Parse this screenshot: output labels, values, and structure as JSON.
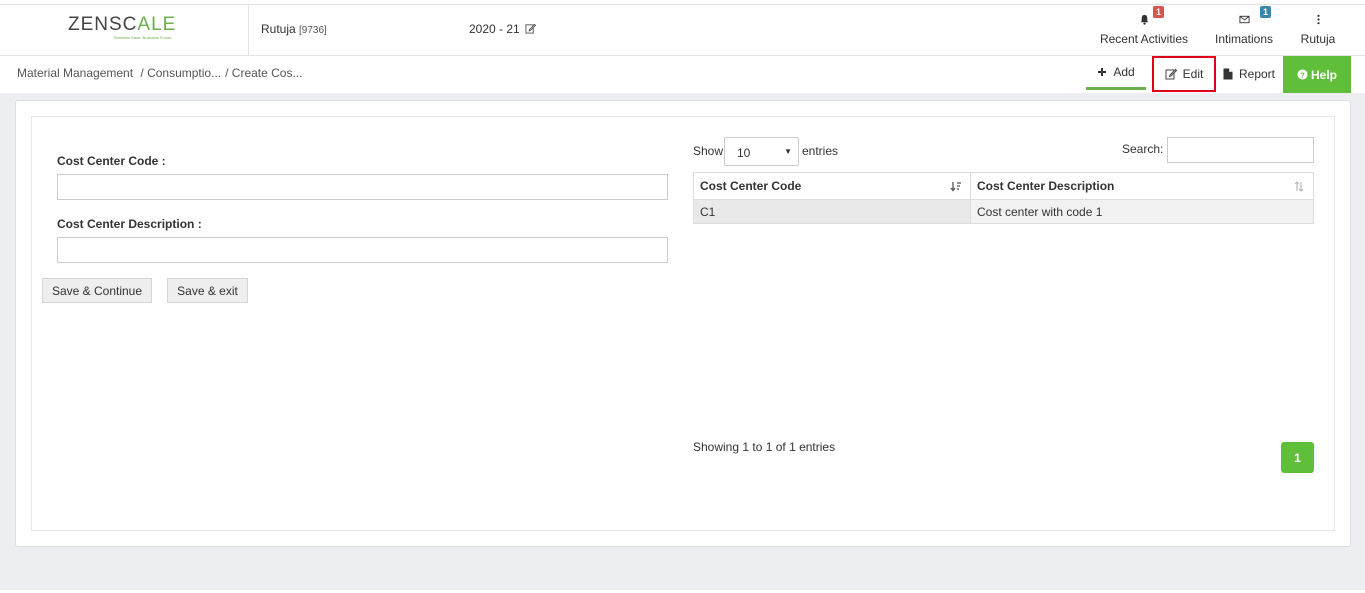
{
  "header": {
    "logo_text_a": "ZENSC",
    "logo_text_accent": "A",
    "logo_text_b": "LE",
    "logo_tagline": "Business Ease. Business Focus.",
    "user_name": "Rutuja",
    "user_id": "[9736]",
    "year": "2020 - 21",
    "items": [
      {
        "label": "Recent Activities",
        "badge": "1",
        "icon": "bell-icon"
      },
      {
        "label": "Intimations",
        "badge": "1",
        "icon": "envelope-icon"
      },
      {
        "label": "Rutuja",
        "icon": "more-vertical-icon"
      }
    ]
  },
  "breadcrumb": {
    "root": "Material Management",
    "mid": "/ Consumptio...",
    "current": "/ Create Cos..."
  },
  "actions": {
    "add": "Add",
    "edit": "Edit",
    "report": "Report",
    "help": "Help"
  },
  "form": {
    "code_label": "Cost Center Code :",
    "code_value": "",
    "desc_label": "Cost Center Description :",
    "desc_value": "",
    "save_continue": "Save & Continue",
    "save_exit": "Save & exit"
  },
  "table": {
    "show_label": "Show",
    "page_size": "10",
    "entries_label": "entries",
    "search_label": "Search:",
    "columns": [
      "Cost Center Code",
      "Cost Center Description"
    ],
    "rows": [
      [
        "C1",
        "Cost center with code 1"
      ]
    ],
    "info": "Showing 1 to 1 of 1 entries",
    "current_page": "1"
  },
  "colors": {
    "accent_green": "#5fbf3a",
    "highlight_red": "#e0001a",
    "badge_red": "#d9534f",
    "badge_blue": "#3a87ad"
  }
}
